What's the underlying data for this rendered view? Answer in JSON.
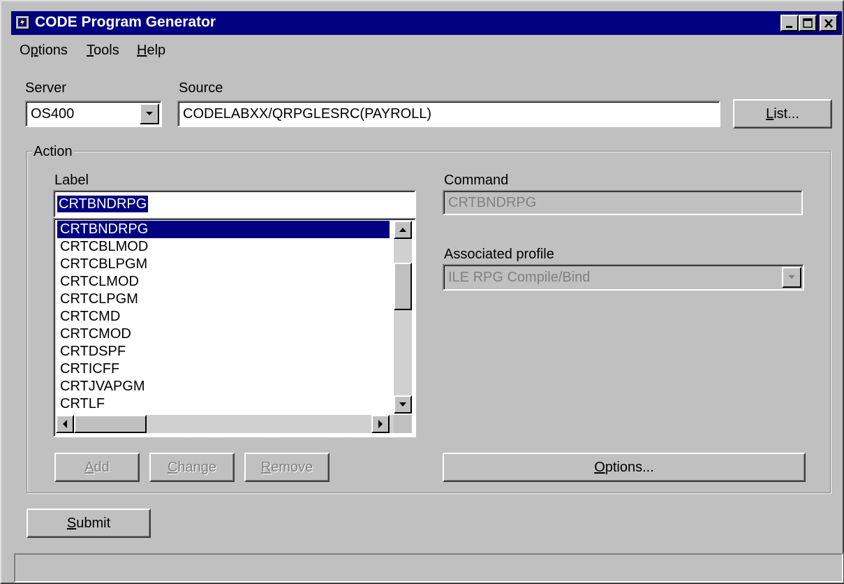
{
  "window": {
    "title": "CODE Program Generator"
  },
  "menu": {
    "items": [
      {
        "pre": "O",
        "ul": "p",
        "post": "tions"
      },
      {
        "pre": "",
        "ul": "T",
        "post": "ools"
      },
      {
        "pre": "",
        "ul": "H",
        "post": "elp"
      }
    ]
  },
  "server": {
    "label": "Server",
    "value": "OS400"
  },
  "source": {
    "label": "Source",
    "value": "CODELABXX/QRPGLESRC(PAYROLL)"
  },
  "list_button": {
    "ul": "L",
    "post": "ist..."
  },
  "action": {
    "legend": "Action",
    "label_caption": "Label",
    "label_value": "CRTBNDRPG",
    "list_items": [
      "CRTBNDRPG",
      "CRTCBLMOD",
      "CRTCBLPGM",
      "CRTCLMOD",
      "CRTCLPGM",
      "CRTCMD",
      "CRTCMOD",
      "CRTDSPF",
      "CRTICFF",
      "CRTJVAPGM",
      "CRTLF"
    ],
    "selected_index": 0,
    "command_caption": "Command",
    "command_value": "CRTBNDRPG",
    "profile_caption": "Associated profile",
    "profile_value": "ILE RPG Compile/Bind",
    "add_button": {
      "ul": "A",
      "post": "dd"
    },
    "change_button": {
      "ul": "C",
      "post": "hange"
    },
    "remove_button": {
      "ul": "R",
      "post": "emove"
    },
    "options_button": {
      "ul": "O",
      "post": "ptions..."
    }
  },
  "submit_button": {
    "ul": "S",
    "post": "ubmit"
  },
  "status": {
    "text": ""
  },
  "icons": [
    "app-icon",
    "minimize-icon",
    "maximize-icon",
    "close-icon",
    "dropdown-arrow-icon",
    "scroll-up-arrow-icon",
    "scroll-down-arrow-icon",
    "scroll-left-arrow-icon",
    "scroll-right-arrow-icon"
  ],
  "colors": {
    "titlebar": "#000080",
    "face": "#c0c0c0",
    "selection": "#000080"
  }
}
